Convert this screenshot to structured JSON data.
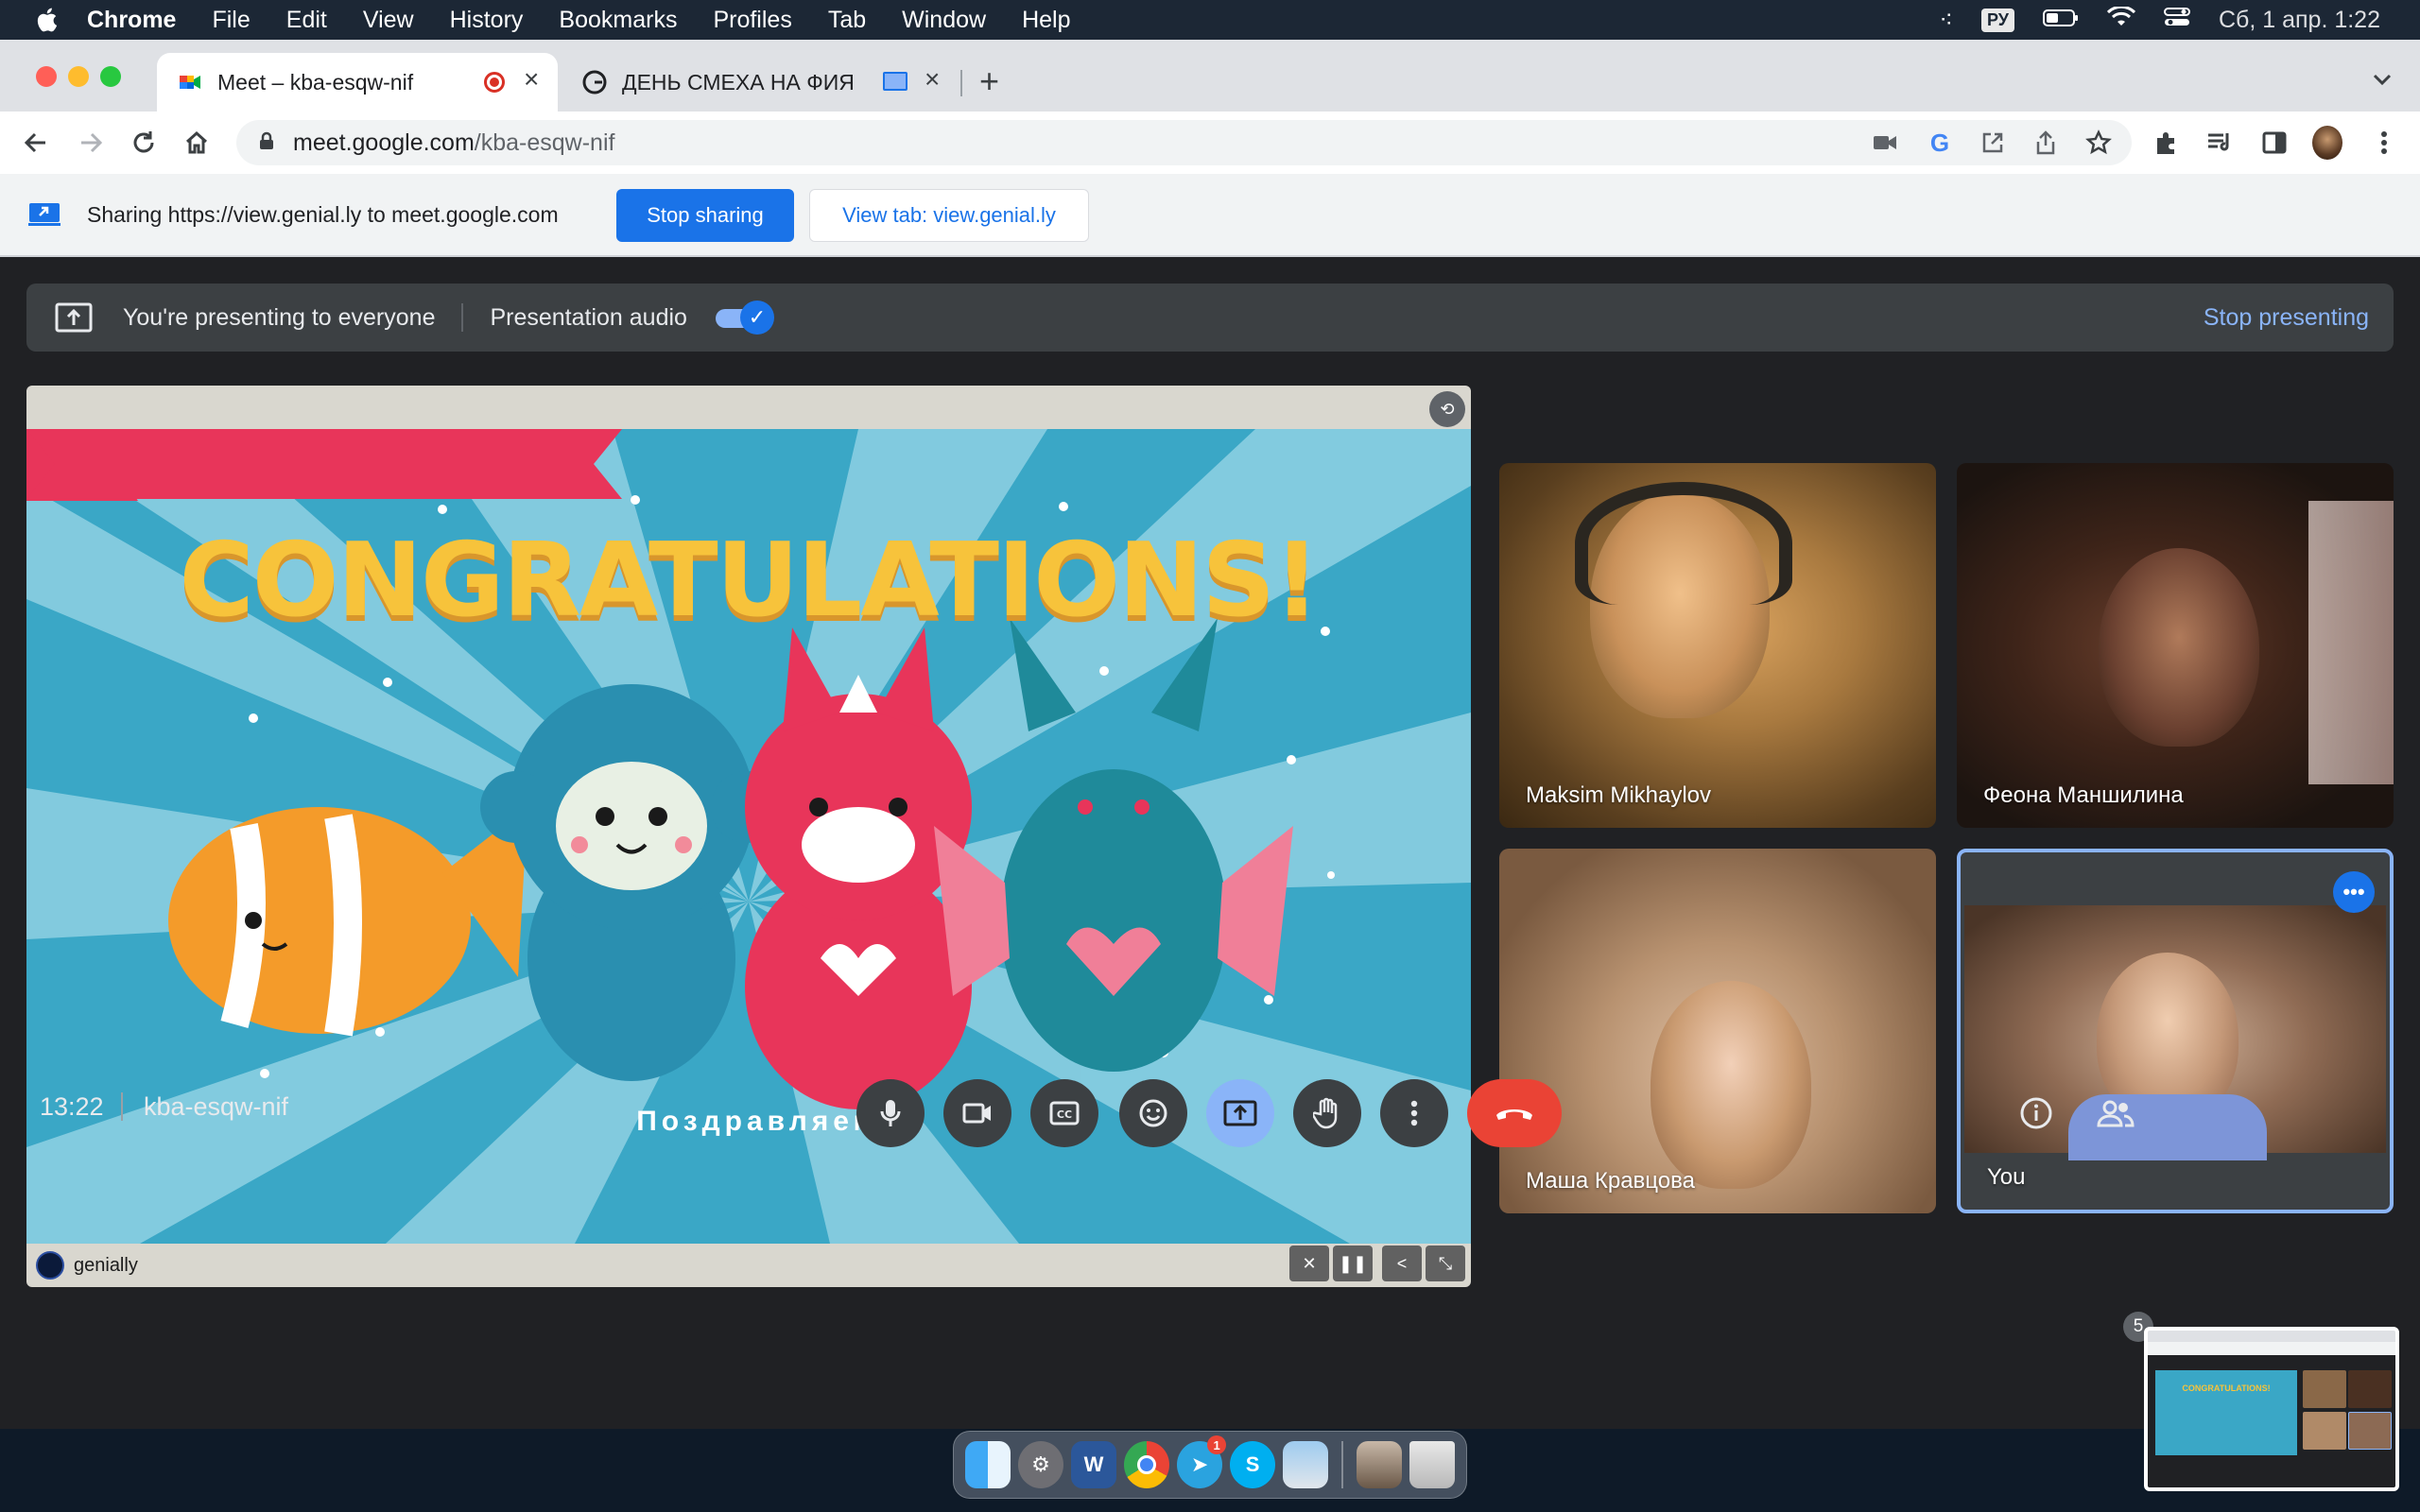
{
  "menubar": {
    "app": "Chrome",
    "items": [
      "File",
      "Edit",
      "View",
      "History",
      "Bookmarks",
      "Profiles",
      "Tab",
      "Window",
      "Help"
    ],
    "input_source": "РУ",
    "datetime": "Сб, 1 апр.  1:22"
  },
  "tabs": [
    {
      "title": "Meet – kba-esqw-nif",
      "recording": true
    },
    {
      "title": "ДЕНЬ СМЕХА НА ФИЯ"
    }
  ],
  "address": {
    "host": "meet.google.com",
    "path": "/kba-esqw-nif"
  },
  "sharebar": {
    "text": "Sharing https://view.genial.ly to meet.google.com",
    "stop_label": "Stop sharing",
    "view_label": "View tab: view.genial.ly"
  },
  "presenting": {
    "status": "You're presenting to everyone",
    "audio_label": "Presentation audio",
    "audio_enabled": true,
    "stop_label": "Stop presenting"
  },
  "slide": {
    "title": "CONGRATULATIONS!",
    "banner": "Поздравляем!",
    "brand": "genially"
  },
  "participants": [
    {
      "name": "Maksim Mikhaylov"
    },
    {
      "name": "Феона Маншилина"
    },
    {
      "name": "Маша Кравцова"
    },
    {
      "name": "You",
      "is_self": true
    }
  ],
  "meeting": {
    "time": "13:22",
    "code": "kba-esqw-nif",
    "people_count": "5"
  },
  "colors": {
    "accent": "#1a73e8",
    "end_call": "#ea4335",
    "meet_bg": "#202124",
    "present_active": "#8ab4f8"
  }
}
